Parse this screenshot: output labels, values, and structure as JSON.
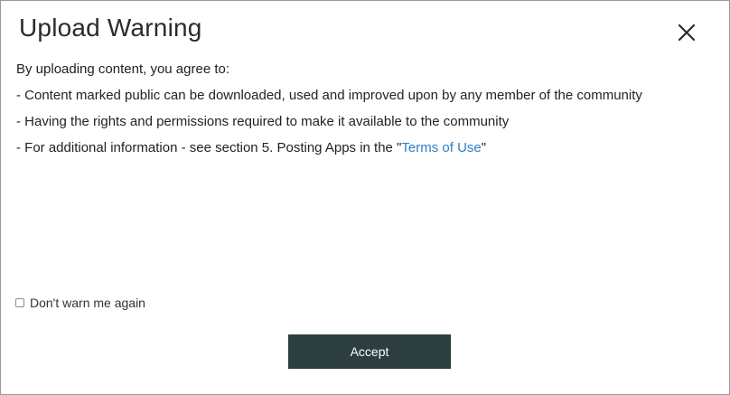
{
  "dialog": {
    "title": "Upload Warning",
    "close_icon": "close-icon",
    "intro": "By uploading content, you agree to:",
    "bullets": {
      "public_content": "- Content marked public can be downloaded, used and improved upon by any member of the community",
      "rights": "- Having the rights and permissions required to make it available to the community",
      "info_prefix": "- For additional information - see section 5. Posting Apps in the \"",
      "info_link": "Terms of Use",
      "info_suffix": "\""
    },
    "dont_warn_label": "Don't warn me again",
    "dont_warn_checked": false,
    "accept_label": "Accept"
  },
  "colors": {
    "accent_button": "#2c3e40",
    "link": "#2f80c4"
  }
}
